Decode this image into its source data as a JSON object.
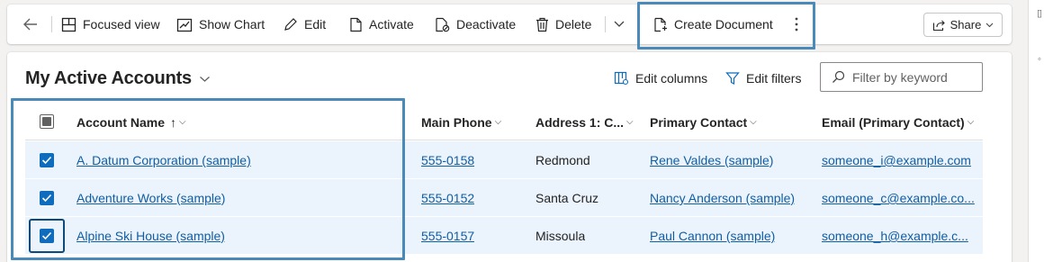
{
  "toolbar": {
    "focused_view": "Focused view",
    "show_chart": "Show Chart",
    "edit": "Edit",
    "activate": "Activate",
    "deactivate": "Deactivate",
    "delete": "Delete",
    "create_document": "Create Document",
    "share": "Share"
  },
  "view": {
    "title": "My Active Accounts",
    "edit_columns": "Edit columns",
    "edit_filters": "Edit filters",
    "filter_placeholder": "Filter by keyword",
    "filter_value": ""
  },
  "columns": {
    "account_name": "Account Name",
    "main_phone": "Main Phone",
    "address_city": "Address 1: C...",
    "primary_contact": "Primary Contact",
    "email": "Email (Primary Contact)"
  },
  "rows": [
    {
      "account_name": "A. Datum Corporation (sample)",
      "main_phone": "555-0158",
      "city": "Redmond",
      "primary_contact": "Rene Valdes (sample)",
      "email": "someone_i@example.com",
      "selected": true
    },
    {
      "account_name": "Adventure Works (sample)",
      "main_phone": "555-0152",
      "city": "Santa Cruz",
      "primary_contact": "Nancy Anderson (sample)",
      "email": "someone_c@example.co...",
      "selected": true
    },
    {
      "account_name": "Alpine Ski House (sample)",
      "main_phone": "555-0157",
      "city": "Missoula",
      "primary_contact": "Paul Cannon (sample)",
      "email": "someone_h@example.c...",
      "selected": true
    }
  ],
  "colors": {
    "accent": "#0f6cbd",
    "link": "#115ea3",
    "highlight_box": "#4a8ab8",
    "row_selected": "#ebf3fc"
  },
  "icons": {
    "back": "back-arrow-icon",
    "focused_view": "focused-view-icon",
    "show_chart": "chart-icon",
    "edit": "pencil-icon",
    "activate": "document-icon",
    "deactivate": "document-deactivate-icon",
    "delete": "trash-icon",
    "overflow": "chevron-down-icon",
    "create_document": "document-add-icon",
    "more": "more-vertical-icon",
    "share": "share-icon",
    "edit_columns": "edit-columns-icon",
    "edit_filters": "filter-icon",
    "search": "search-icon"
  }
}
